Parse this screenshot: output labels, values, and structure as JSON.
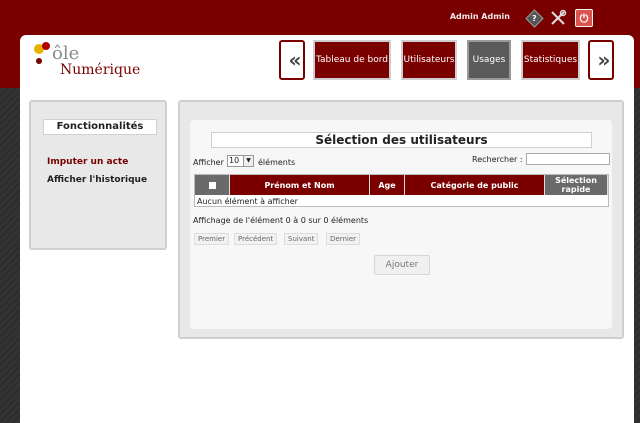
{
  "topbar": {
    "username": "Admin Admin",
    "icons": [
      "help-icon",
      "tools-icon",
      "power-icon"
    ]
  },
  "logo": {
    "line1": "ôle",
    "line2": "Numérique"
  },
  "nav": {
    "tabs": [
      {
        "label": "Tableau de bord",
        "active": false
      },
      {
        "label": "Utilisateurs",
        "active": false
      },
      {
        "label": "Usages",
        "active": true
      },
      {
        "label": "Statistiques",
        "active": false
      }
    ],
    "prev_glyph": "«",
    "next_glyph": "»"
  },
  "sidebar": {
    "title": "Fonctionnalités",
    "items": [
      {
        "label": "Imputer un acte"
      },
      {
        "label": "Afficher l'historique"
      }
    ]
  },
  "panel": {
    "title": "Sélection des utilisateurs",
    "length_prefix": "Afficher",
    "length_value": "10",
    "length_suffix": "éléments",
    "search_label": "Rechercher :",
    "search_value": "",
    "table": {
      "columns": [
        "",
        "Prénom et Nom",
        "Age",
        "Catégorie de public",
        "Sélection rapide"
      ],
      "empty_message": "Aucun élément à afficher"
    },
    "info": "Affichage de l'élément 0 à 0 sur 0 éléments",
    "pager": [
      "Premier",
      "Précédent",
      "Suivant",
      "Dernier"
    ],
    "add_button": "Ajouter"
  },
  "colors": {
    "brand": "#7a0000",
    "active_tab": "#5a5a5a"
  }
}
